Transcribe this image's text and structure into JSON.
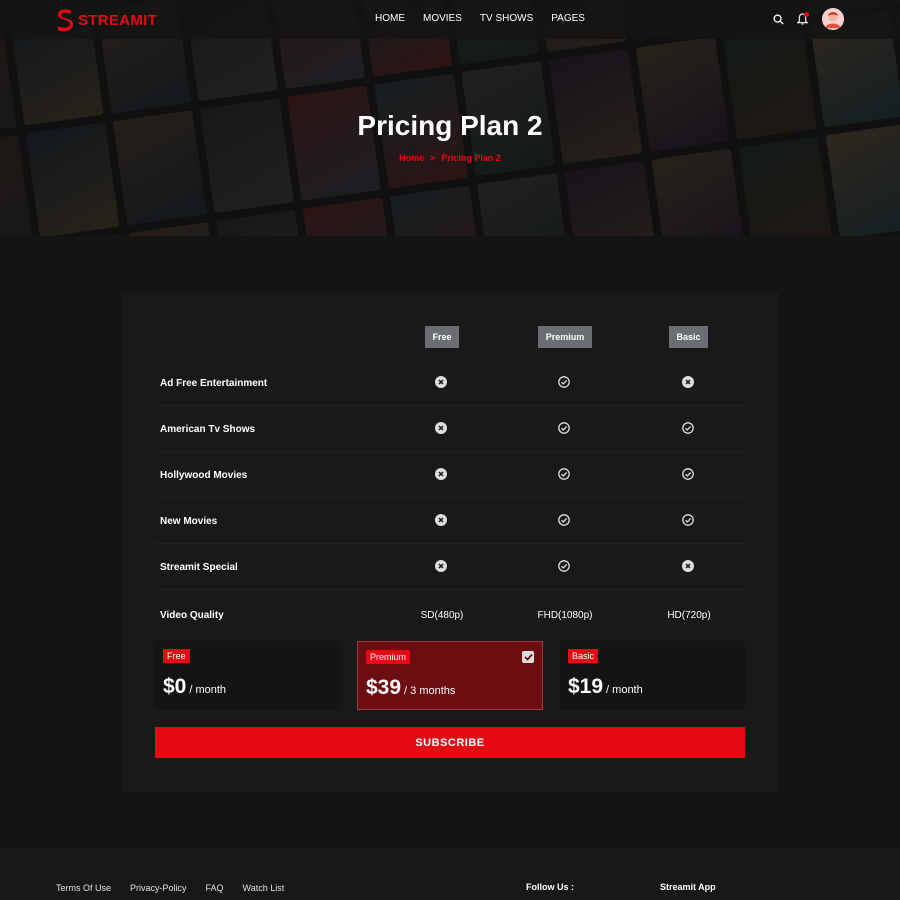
{
  "header": {
    "logo_text": "STREAMIT",
    "nav": [
      "HOME",
      "MOVIES",
      "TV SHOWS",
      "PAGES"
    ]
  },
  "banner": {
    "title": "Pricing Plan 2",
    "breadcrumb_home": "Home",
    "breadcrumb_separator": ">",
    "breadcrumb_current": "Pricing Plan 2"
  },
  "pricing": {
    "columns": [
      "Free",
      "Premium",
      "Basic"
    ],
    "features": [
      {
        "label": "Ad Free Entertainment",
        "marks": [
          "no",
          "yes",
          "no"
        ]
      },
      {
        "label": "American Tv Shows",
        "marks": [
          "no",
          "yes",
          "yes"
        ]
      },
      {
        "label": "Hollywood Movies",
        "marks": [
          "no",
          "yes",
          "yes"
        ]
      },
      {
        "label": "New Movies",
        "marks": [
          "no",
          "yes",
          "yes"
        ]
      },
      {
        "label": "Streamit Special",
        "marks": [
          "no",
          "yes",
          "no"
        ]
      }
    ],
    "quality_label": "Video Quality",
    "quality": [
      "SD(480p)",
      "FHD(1080p)",
      "HD(720p)"
    ],
    "plans": [
      {
        "badge": "Free",
        "price": "$0",
        "period": "/ month",
        "selected": false
      },
      {
        "badge": "Premium",
        "price": "$39",
        "period": "/ 3 months",
        "selected": true
      },
      {
        "badge": "Basic",
        "price": "$19",
        "period": "/ month",
        "selected": false
      }
    ],
    "subscribe_label": "SUBSCRIBE"
  },
  "footer": {
    "links": [
      "Terms Of Use",
      "Privacy-Policy",
      "FAQ",
      "Watch List"
    ],
    "follow_label": "Follow Us :",
    "app_label": "Streamit App"
  },
  "colors": {
    "accent": "#e50914",
    "background": "#141414",
    "card": "#191919",
    "column_header": "#6a6e73",
    "selected_plan": "#6b0d11"
  },
  "icons": {
    "check": "check-circle-icon",
    "cross": "times-circle-icon"
  }
}
